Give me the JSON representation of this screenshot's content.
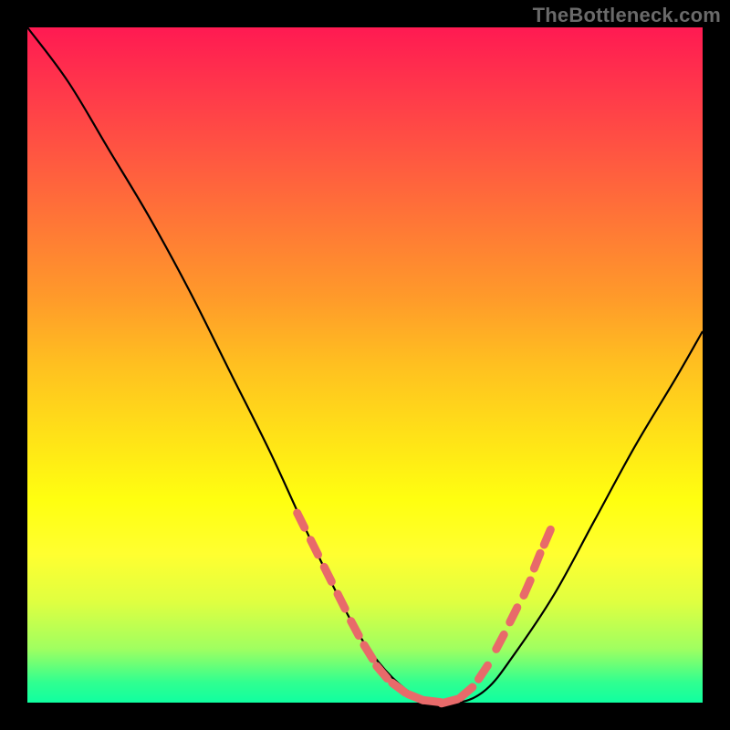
{
  "watermark": "TheBottleneck.com",
  "chart_data": {
    "type": "line",
    "title": "",
    "xlabel": "",
    "ylabel": "",
    "xlim": [
      0,
      100
    ],
    "ylim": [
      0,
      100
    ],
    "grid": false,
    "legend": false,
    "series": [
      {
        "name": "curve",
        "x": [
          0,
          6,
          12,
          18,
          24,
          30,
          36,
          42,
          48,
          52,
          56,
          60,
          64,
          68,
          72,
          78,
          84,
          90,
          96,
          100
        ],
        "y": [
          100,
          92,
          82,
          72,
          61,
          49,
          37,
          24,
          12,
          6,
          2,
          0,
          0,
          2,
          7,
          16,
          27,
          38,
          48,
          55
        ]
      }
    ],
    "highlight_segments": {
      "name": "red-dashes",
      "color": "#e86a6a",
      "points": [
        {
          "x": 40.5,
          "y": 27
        },
        {
          "x": 42.5,
          "y": 23
        },
        {
          "x": 44.5,
          "y": 19
        },
        {
          "x": 46.5,
          "y": 15
        },
        {
          "x": 48.5,
          "y": 11
        },
        {
          "x": 50.5,
          "y": 7.5
        },
        {
          "x": 52.5,
          "y": 4.5
        },
        {
          "x": 55.0,
          "y": 2.2
        },
        {
          "x": 57.5,
          "y": 0.8
        },
        {
          "x": 60.0,
          "y": 0.2
        },
        {
          "x": 62.5,
          "y": 0.2
        },
        {
          "x": 65.0,
          "y": 1.5
        },
        {
          "x": 67.5,
          "y": 4.5
        },
        {
          "x": 70.0,
          "y": 9
        },
        {
          "x": 72.0,
          "y": 13
        },
        {
          "x": 74.0,
          "y": 17
        },
        {
          "x": 75.5,
          "y": 21
        },
        {
          "x": 77.0,
          "y": 24.5
        }
      ]
    },
    "background_gradient": {
      "top": "#ff1a52",
      "middle": "#ffe018",
      "bottom": "#10ffa0"
    }
  }
}
